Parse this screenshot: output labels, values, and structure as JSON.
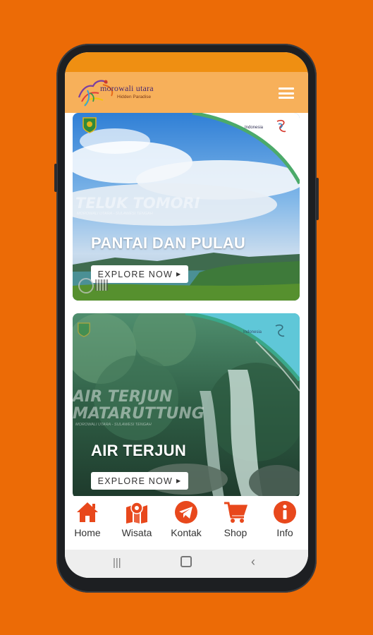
{
  "header": {
    "logo_brand": "morowali utara",
    "logo_tagline": "Hidden Paradise"
  },
  "cards": [
    {
      "overlay_title": "TELUK TOMORI",
      "overlay_sub": "MOROWALI UTARA - SULAWESI TENGAH",
      "partner_logo": "Indonesia",
      "category": "PANTAI DAN PULAU",
      "button": "EXPLORE NOW"
    },
    {
      "overlay_title_line1": "AIR TERJUN",
      "overlay_title_line2": "MATARUTTUNG",
      "overlay_sub": "MOROWALI UTARA - SULAWESI TENGAH",
      "partner_logo": "Indonesia",
      "category": "AIR TERJUN",
      "button": "EXPLORE NOW"
    }
  ],
  "bottom_nav": [
    {
      "label": "Home",
      "icon": "home-icon"
    },
    {
      "label": "Wisata",
      "icon": "map-pin-icon"
    },
    {
      "label": "Kontak",
      "icon": "telegram-icon"
    },
    {
      "label": "Shop",
      "icon": "cart-icon"
    },
    {
      "label": "Info",
      "icon": "info-icon"
    }
  ],
  "colors": {
    "background": "#ec6b06",
    "header": "#f7b05a",
    "statusbar": "#ef8f12",
    "accent": "#e8481c"
  }
}
